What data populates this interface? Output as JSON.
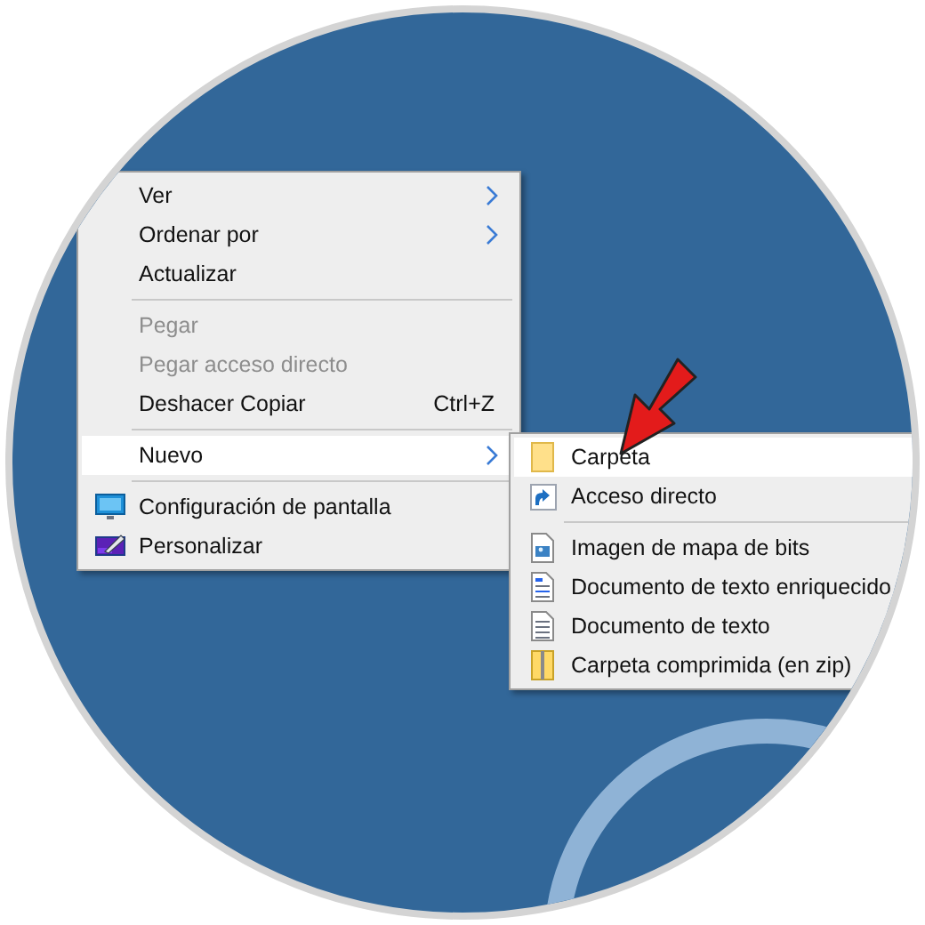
{
  "context_menu": {
    "items": [
      {
        "kind": "item",
        "label": "Ver",
        "submenu": true,
        "disabled": false,
        "selected": false
      },
      {
        "kind": "item",
        "label": "Ordenar por",
        "submenu": true,
        "disabled": false,
        "selected": false
      },
      {
        "kind": "item",
        "label": "Actualizar",
        "submenu": false,
        "disabled": false,
        "selected": false
      },
      {
        "kind": "separator"
      },
      {
        "kind": "item",
        "label": "Pegar",
        "submenu": false,
        "disabled": true,
        "selected": false
      },
      {
        "kind": "item",
        "label": "Pegar acceso directo",
        "submenu": false,
        "disabled": true,
        "selected": false
      },
      {
        "kind": "item",
        "label": "Deshacer Copiar",
        "shortcut": "Ctrl+Z",
        "submenu": false,
        "disabled": false,
        "selected": false
      },
      {
        "kind": "separator"
      },
      {
        "kind": "item",
        "label": "Nuevo",
        "submenu": true,
        "disabled": false,
        "selected": true
      },
      {
        "kind": "separator"
      },
      {
        "kind": "item",
        "label": "Configuración de pantalla",
        "submenu": false,
        "disabled": false,
        "selected": false
      },
      {
        "kind": "item",
        "label": "Personalizar",
        "submenu": false,
        "disabled": false,
        "selected": false
      }
    ]
  },
  "submenu": {
    "items": [
      {
        "kind": "item",
        "label": "Carpeta",
        "selected": true
      },
      {
        "kind": "item",
        "label": "Acceso directo",
        "selected": false
      },
      {
        "kind": "separator"
      },
      {
        "kind": "item",
        "label": "Imagen de mapa de bits",
        "selected": false
      },
      {
        "kind": "item",
        "label": "Documento de texto enriquecido",
        "selected": false
      },
      {
        "kind": "item",
        "label": "Documento de texto",
        "selected": false
      },
      {
        "kind": "item",
        "label": "Carpeta comprimida (en zip)",
        "selected": false
      }
    ]
  }
}
